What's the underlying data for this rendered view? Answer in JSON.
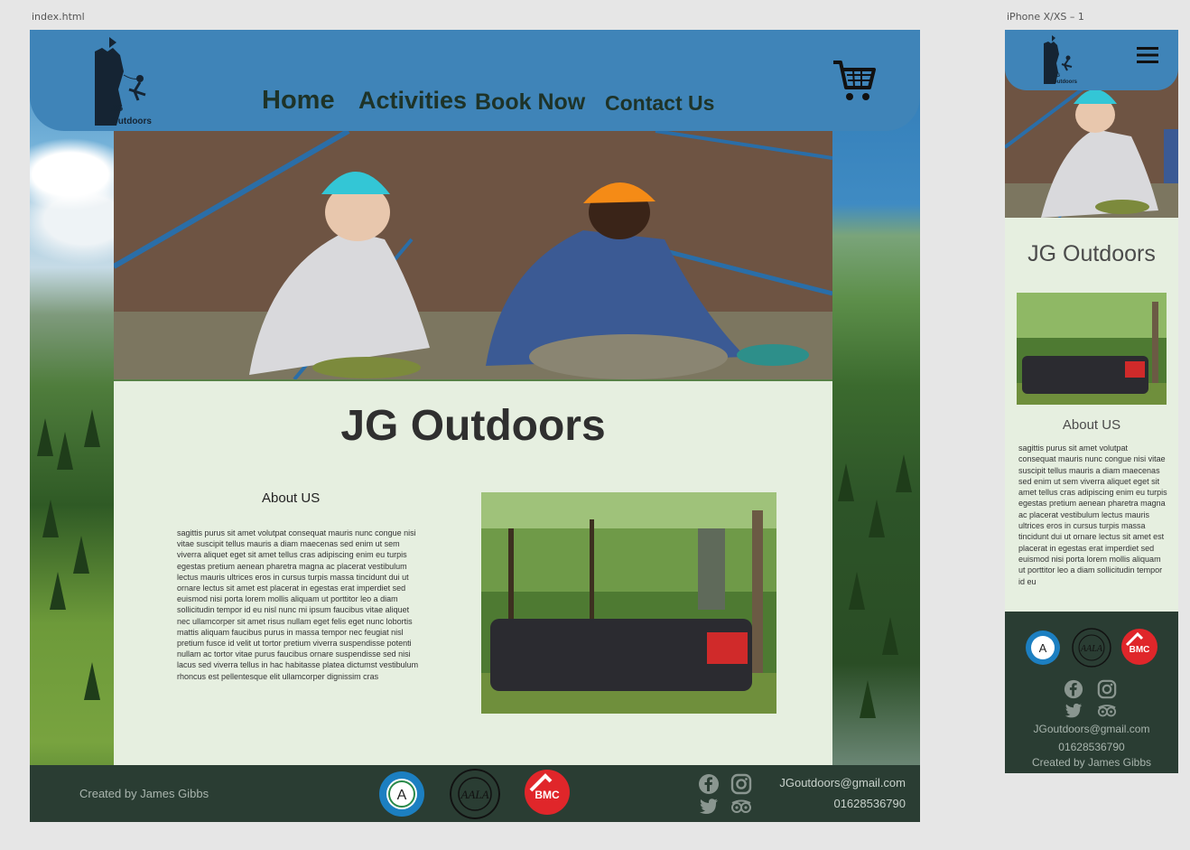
{
  "canvas": {
    "desktop_label": "index.html",
    "mobile_label": "iPhone X/XS – 1"
  },
  "desktop": {
    "logo_text": [
      "JG",
      "Outdoors"
    ],
    "nav": {
      "home": "Home",
      "activities": "Activities",
      "book": "Book Now",
      "contact": "Contact Us"
    },
    "title": "JG Outdoors",
    "about_heading": "About US",
    "about_text": "sagittis purus sit amet volutpat consequat mauris nunc congue nisi vitae suscipit tellus mauris a diam maecenas sed enim ut sem viverra aliquet eget sit amet tellus cras adipiscing enim eu turpis egestas pretium aenean pharetra magna ac placerat vestibulum lectus mauris ultrices eros in cursus turpis massa tincidunt dui ut ornare lectus sit amet est placerat in egestas erat imperdiet sed euismod nisi porta lorem mollis aliquam ut porttitor leo a diam sollicitudin tempor id eu nisl nunc mi ipsum faucibus vitae aliquet nec ullamcorper sit amet risus nullam eget felis eget nunc lobortis mattis aliquam faucibus purus in massa tempor nec feugiat nisl pretium fusce id velit ut tortor pretium viverra suspendisse potenti nullam ac tortor vitae purus faucibus ornare suspendisse sed nisi lacus sed viverra tellus in hac habitasse platea dictumst vestibulum rhoncus est pellentesque elit ullamcorper dignissim cras",
    "footer": {
      "created_by": "Created by James Gibbs",
      "email": "JGoutdoors@gmail.com",
      "phone": "01628536790",
      "badges": {
        "aala": "AALA",
        "bmc": "BMC",
        "a_badge": "A"
      }
    }
  },
  "mobile": {
    "logo_text": [
      "JG",
      "Outdoors"
    ],
    "title": "JG Outdoors",
    "about_heading": "About US",
    "about_text": "sagittis purus sit amet volutpat consequat mauris nunc congue nisi vitae suscipit tellus mauris a diam maecenas sed enim ut sem viverra aliquet eget sit amet tellus cras adipiscing enim eu turpis egestas pretium aenean pharetra magna ac placerat vestibulum lectus mauris ultrices eros in cursus turpis massa tincidunt dui ut ornare lectus sit amet est placerat in egestas erat imperdiet sed euismod nisi porta lorem mollis aliquam ut porttitor leo a diam sollicitudin tempor id eu",
    "footer": {
      "email": "JGoutdoors@gmail.com",
      "phone": "01628536790",
      "created_by": "Created by James Gibbs",
      "badges": {
        "aala": "AALA",
        "bmc": "BMC",
        "a_badge": "A"
      }
    }
  },
  "colors": {
    "header_blue": "#3f84b8",
    "footer_green": "#2a3d33",
    "content_bg": "#e6efe0",
    "nav_text": "#1e3328",
    "bmc_red": "#e0262a"
  },
  "icons": [
    "cart-icon",
    "facebook-icon",
    "instagram-icon",
    "twitter-icon",
    "tripadvisor-icon",
    "hamburger-menu-icon"
  ]
}
